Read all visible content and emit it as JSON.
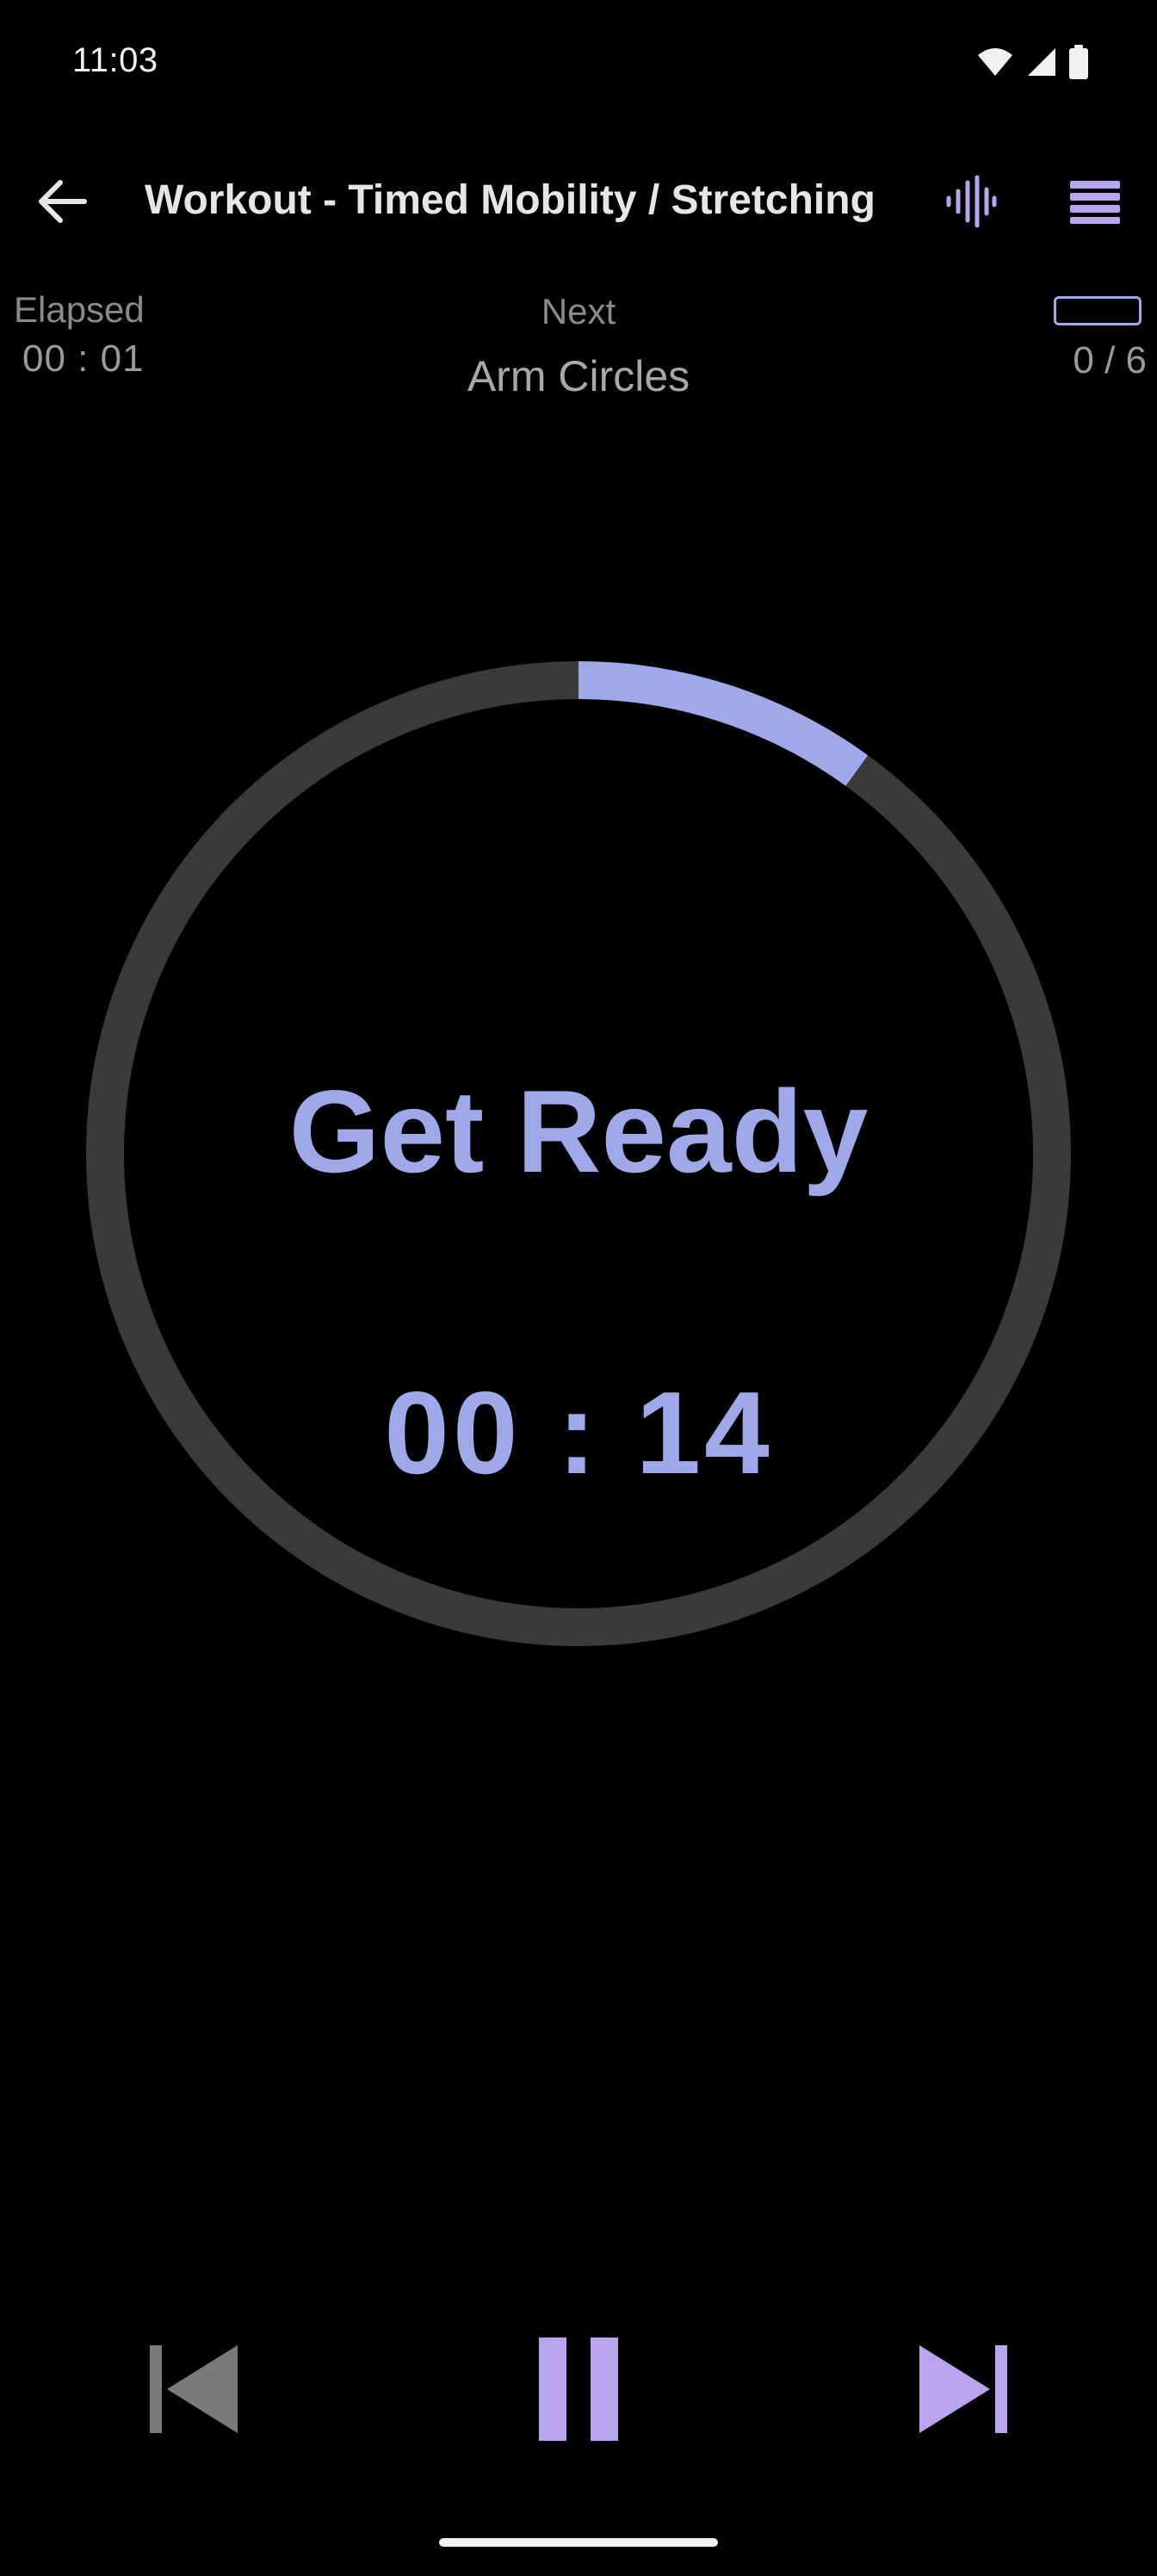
{
  "status_bar": {
    "time": "11:03"
  },
  "toolbar": {
    "title": "Workout - Timed Mobility / Stretching",
    "back_icon": "arrow-back-icon",
    "audio_icon": "audio-wave-icon",
    "menu_icon": "menu-icon"
  },
  "info": {
    "elapsed_label": "Elapsed",
    "elapsed_value": "00 : 01",
    "next_label": "Next",
    "next_value": "Arm Circles",
    "progress_count": "0 / 6"
  },
  "timer": {
    "state": "Get Ready",
    "time": "00 : 14",
    "progress_fraction": 0.1
  },
  "controls": {
    "previous_icon": "skip-previous-icon",
    "pause_icon": "pause-icon",
    "next_icon": "skip-next-icon"
  },
  "colors": {
    "accent": "#9fa8e8",
    "icon_accent": "#b9a4ee",
    "ring_track": "#3a3a3a",
    "disabled": "#7a7a7a"
  }
}
